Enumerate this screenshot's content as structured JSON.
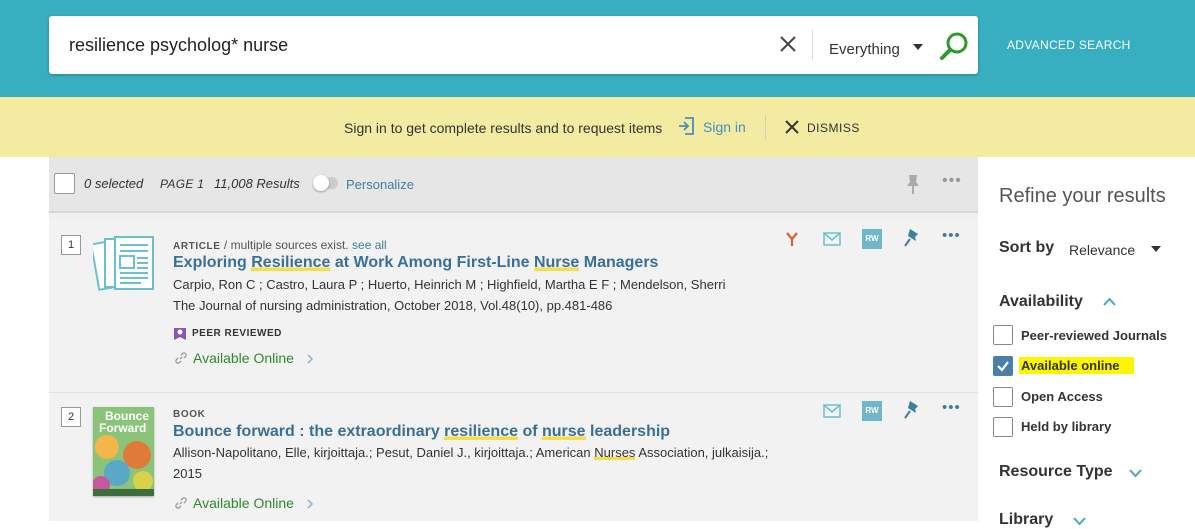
{
  "search": {
    "query": "resilience psycholog* nurse",
    "scope": "Everything",
    "advanced_label": "ADVANCED SEARCH"
  },
  "signin_bar": {
    "message": "Sign in to get complete results and to request items",
    "signin_label": "Sign in",
    "dismiss_label": "DISMISS"
  },
  "results_header": {
    "selected": "0 selected",
    "page": "PAGE 1",
    "count": "11,008 Results",
    "personalize": "Personalize"
  },
  "results": [
    {
      "number": "1",
      "type": "ARTICLE",
      "type_note": "/ multiple sources exist.",
      "see_all": "see all",
      "title_parts": [
        "Exploring ",
        "Resilience",
        " at Work Among First-Line ",
        "Nurse",
        " Managers"
      ],
      "authors": "Carpio, Ron C ; Castro, Laura P ; Huerto, Heinrich M ; Highfield, Martha E F ; Mendelson, Sherri",
      "source": "The Journal of nursing administration, October 2018, Vol.48(10), pp.481-486",
      "peer_reviewed": "PEER REVIEWED",
      "availability": "Available Online",
      "actions": [
        "citation-trail",
        "email",
        "refworks",
        "pin",
        "more"
      ]
    },
    {
      "number": "2",
      "type": "BOOK",
      "title_parts": [
        "Bounce forward : the extraordinary ",
        "resilience",
        " of ",
        "nurse",
        " leadership"
      ],
      "authors_parts": [
        "Allison-Napolitano, Elle, kirjoittaja.; Pesut, Daniel J., kirjoittaja.; American ",
        "Nurses",
        " Association, julkaisija.;"
      ],
      "year": "2015",
      "cover_title_1": "Bounce",
      "cover_title_2": "Forward",
      "availability": "Available Online",
      "actions": [
        "email",
        "refworks",
        "pin",
        "more"
      ]
    }
  ],
  "refine": {
    "title": "Refine your results",
    "sort_label": "Sort by",
    "sort_value": "Relevance",
    "availability_heading": "Availability",
    "availability_options": [
      {
        "label": "Peer-reviewed Journals",
        "checked": false
      },
      {
        "label": "Available online",
        "checked": true
      },
      {
        "label": "Open Access",
        "checked": false
      },
      {
        "label": "Held by library",
        "checked": false
      }
    ],
    "resource_type_heading": "Resource Type",
    "library_heading": "Library"
  },
  "icons": {
    "rw_badge": "RW",
    "more": "•••"
  },
  "colors": {
    "header_teal": "#38aec1",
    "signin_bar": "#f4eba3",
    "title_link": "#3a6f9a",
    "available_green": "#2f8a2f",
    "highlight_yellow": "#fbf600",
    "keyword_underline": "#f6dd4a",
    "checkbox_checked": "#4a7fa8"
  }
}
